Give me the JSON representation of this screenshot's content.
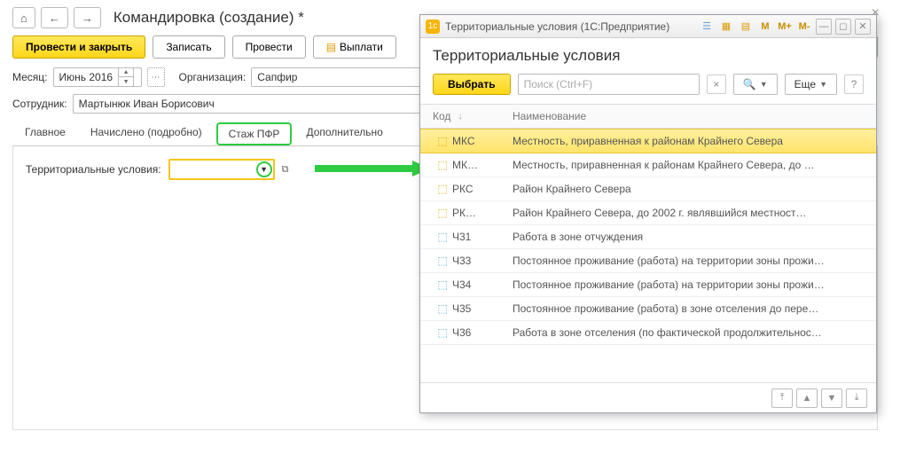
{
  "main": {
    "title": "Командировка (создание) *",
    "nav": {
      "home": "⌂",
      "back": "←",
      "forward": "→"
    },
    "buttons": {
      "post_close": "Провести и закрыть",
      "write": "Записать",
      "post": "Провести",
      "pay": "Выплати",
      "help": "?"
    },
    "fields": {
      "month_label": "Месяц:",
      "month_value": "Июнь 2016",
      "org_label": "Организация:",
      "org_value": "Сапфир",
      "emp_label": "Сотрудник:",
      "emp_value": "Мартынюк Иван Борисович",
      "terr_label": "Территориальные условия:"
    },
    "tabs": {
      "main": "Главное",
      "accrued": "Начислено (подробно)",
      "pfr": "Стаж ПФР",
      "extra": "Дополнительно"
    }
  },
  "dialog": {
    "win_title": "Территориальные условия (1С:Предприятие)",
    "tools": {
      "m": "M",
      "mplus": "M+",
      "mminus": "M-"
    },
    "header": "Территориальные условия",
    "select": "Выбрать",
    "search_placeholder": "Поиск (Ctrl+F)",
    "more": "Еще",
    "help": "?",
    "columns": {
      "code": "Код",
      "name": "Наименование"
    },
    "rows": [
      {
        "code": "МКС",
        "name": "Местность, приравненная к районам Крайнего Севера",
        "selected": true,
        "iconColor": "#e0a400"
      },
      {
        "code": "МК…",
        "name": "Местность, приравненная к районам Крайнего Севера, до …",
        "iconColor": "#e0a400"
      },
      {
        "code": "РКС",
        "name": "Район Крайнего Севера",
        "iconColor": "#e0a400"
      },
      {
        "code": "РК…",
        "name": "Район Крайнего Севера, до 2002 г. являвшийся местност…",
        "iconColor": "#e0a400"
      },
      {
        "code": "Ч31",
        "name": "Работа в зоне отчуждения",
        "iconColor": "#5fa8d3"
      },
      {
        "code": "Ч33",
        "name": "Постоянное проживание (работа) на территории зоны прожи…",
        "iconColor": "#5fa8d3"
      },
      {
        "code": "Ч34",
        "name": "Постоянное проживание (работа) на территории зоны прожи…",
        "iconColor": "#5fa8d3"
      },
      {
        "code": "Ч35",
        "name": "Постоянное проживание (работа) в зоне отселения до пере…",
        "iconColor": "#5fa8d3"
      },
      {
        "code": "Ч36",
        "name": "Работа в зоне отселения (по фактической продолжительнос…",
        "iconColor": "#5fa8d3"
      }
    ]
  }
}
